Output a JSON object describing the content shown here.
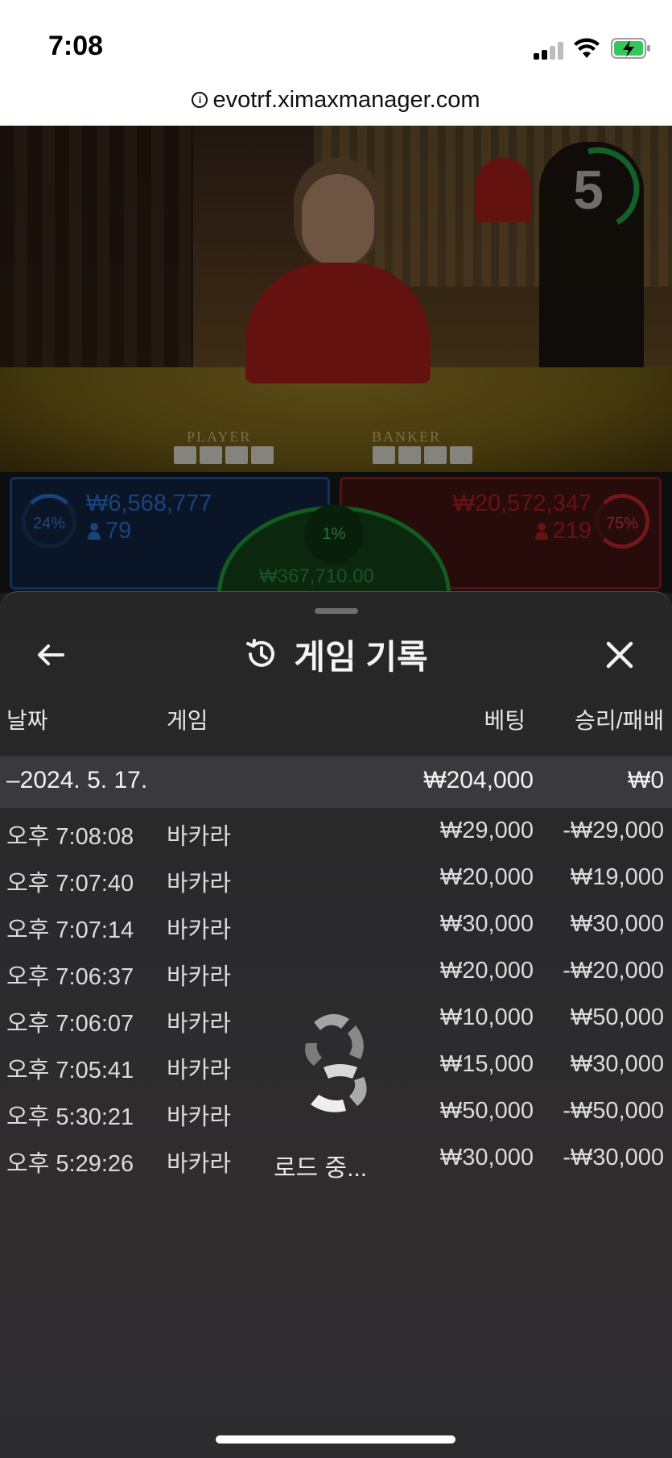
{
  "status_bar": {
    "time": "7:08"
  },
  "browser": {
    "url": "evotrf.ximaxmanager.com"
  },
  "timer": {
    "seconds": "5"
  },
  "table_labels": {
    "player": "PLAYER",
    "banker": "BANKER"
  },
  "bets": {
    "player": {
      "percent": "24%",
      "amount": "₩6,568,777",
      "players": "79"
    },
    "banker": {
      "percent": "75%",
      "amount": "₩20,572,347",
      "players": "219"
    },
    "tie": {
      "percent": "1%",
      "amount": "₩367,710.00"
    }
  },
  "sheet": {
    "title": "게임 기록",
    "columns": {
      "date": "날짜",
      "game": "게임",
      "bet": "베팅",
      "win_loss": "승리/패배"
    },
    "date_group": {
      "date": "–2024. 5. 17.",
      "bet_total": "₩204,000",
      "win_total": "₩0"
    },
    "rows": [
      {
        "time": "오후 7:08:08",
        "game": "바카라",
        "bet": "₩29,000",
        "result": "-₩29,000"
      },
      {
        "time": "오후 7:07:40",
        "game": "바카라",
        "bet": "₩20,000",
        "result": "₩19,000"
      },
      {
        "time": "오후 7:07:14",
        "game": "바카라",
        "bet": "₩30,000",
        "result": "₩30,000"
      },
      {
        "time": "오후 7:06:37",
        "game": "바카라",
        "bet": "₩20,000",
        "result": "-₩20,000"
      },
      {
        "time": "오후 7:06:07",
        "game": "바카라",
        "bet": "₩10,000",
        "result": "₩50,000"
      },
      {
        "time": "오후 7:05:41",
        "game": "바카라",
        "bet": "₩15,000",
        "result": "₩30,000"
      },
      {
        "time": "오후 5:30:21",
        "game": "바카라",
        "bet": "₩50,000",
        "result": "-₩50,000"
      },
      {
        "time": "오후 5:29:26",
        "game": "바카라",
        "bet": "₩30,000",
        "result": "-₩30,000"
      }
    ],
    "loading_text": "로드 중..."
  },
  "colors": {
    "player": "#1d56b0",
    "banker": "#c02222",
    "tie": "#21a83a",
    "timer": "#1fb14a"
  },
  "icons": [
    "info-icon",
    "signal-icon",
    "wifi-icon",
    "battery-charging-icon",
    "back-arrow-icon",
    "history-icon",
    "close-icon",
    "loading-spinner-icon"
  ]
}
